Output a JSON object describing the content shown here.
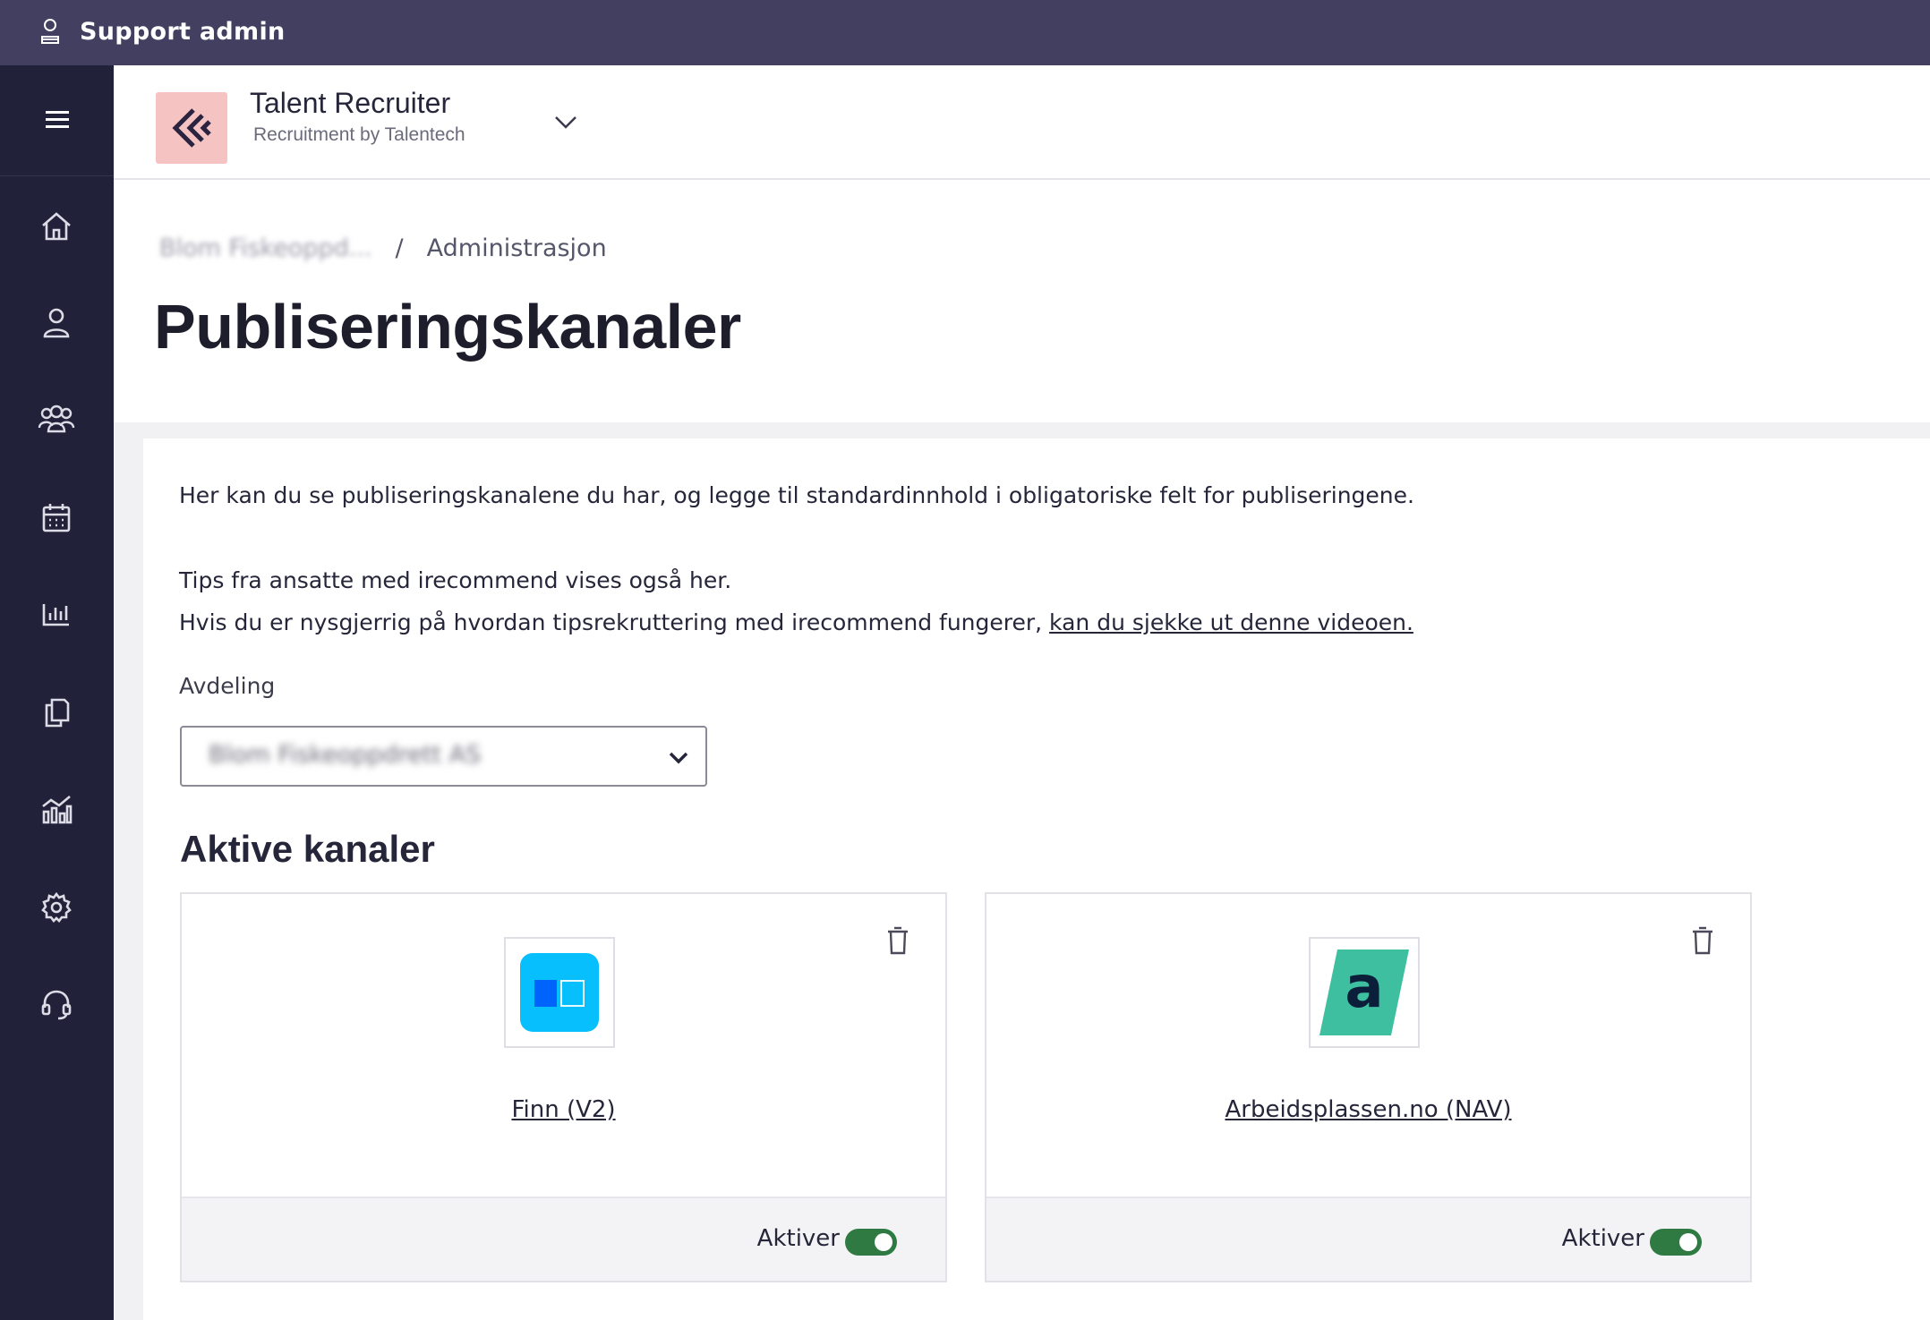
{
  "topbar": {
    "icon": "support-admin-icon",
    "label": "Support admin"
  },
  "sidebar": {
    "items": [
      {
        "icon": "home-icon"
      },
      {
        "icon": "user-icon"
      },
      {
        "icon": "users-icon"
      },
      {
        "icon": "calendar-icon"
      },
      {
        "icon": "bar-chart-icon"
      },
      {
        "icon": "documents-icon"
      },
      {
        "icon": "analytics-icon"
      },
      {
        "icon": "settings-icon"
      },
      {
        "icon": "support-headset-icon"
      }
    ]
  },
  "header": {
    "app_title": "Talent Recruiter",
    "app_subtitle": "Recruitment by Talentech"
  },
  "breadcrumb": {
    "parent": "Blom Fiskeoppd...",
    "separator": "/",
    "current": "Administrasjon"
  },
  "page": {
    "title": "Publiseringskanaler"
  },
  "intro": {
    "line1": "Her kan du se publiseringskanalene du har, og legge til standardinnhold i obligatoriske felt for publiseringene.",
    "line2": "Tips fra ansatte med irecommend vises også her.",
    "line3": "Hvis du er nysgjerrig på hvordan tipsrekruttering med irecommend fungerer, ",
    "link": "kan du sjekke ut denne videoen."
  },
  "department": {
    "label": "Avdeling",
    "value": "Blom Fiskeoppdrett AS"
  },
  "active_channels": {
    "title": "Aktive kanaler",
    "items": [
      {
        "name": "Finn (V2)",
        "toggle_label": "Aktiver",
        "active": true,
        "color": "#06bffc"
      },
      {
        "name": "Arbeidsplassen.no (NAV)",
        "toggle_label": "Aktiver",
        "active": true,
        "color": "#3ebfa0"
      }
    ]
  },
  "colors": {
    "topbar": "#433f60",
    "sidebar": "#21223a",
    "toggle_on": "#2f7a43",
    "logo_bg": "#f6c3c3"
  }
}
